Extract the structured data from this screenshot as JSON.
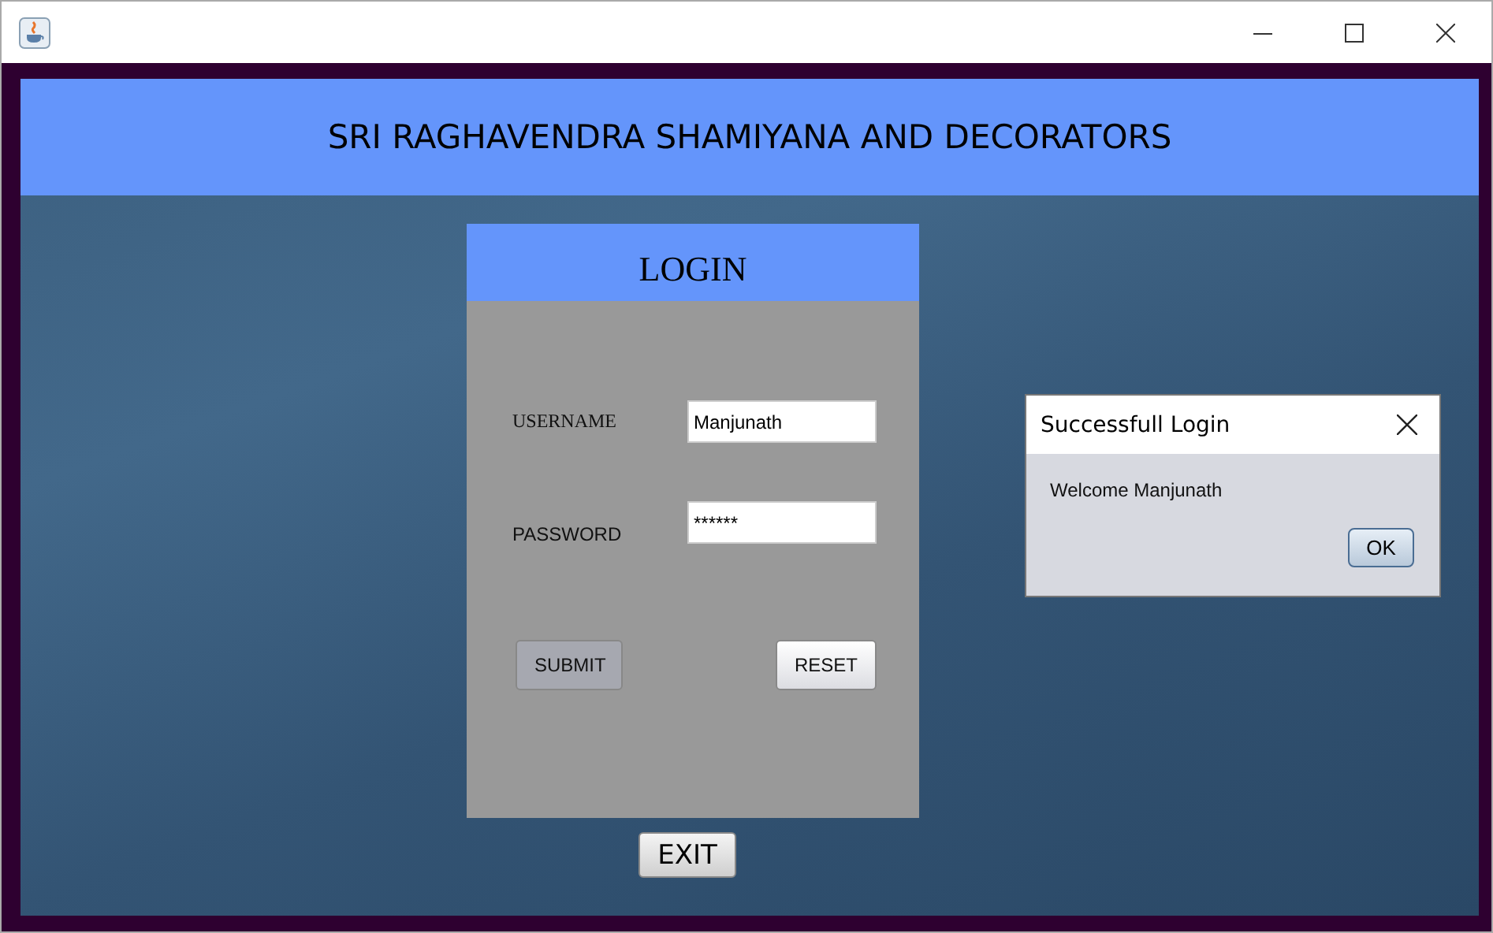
{
  "header": {
    "title": "SRI RAGHAVENDRA SHAMIYANA AND DECORATORS"
  },
  "login": {
    "title": "LOGIN",
    "fields": [
      {
        "label": "USERNAME",
        "value": "Manjunath",
        "kind": "text"
      },
      {
        "label": "PASSWORD",
        "value": "******",
        "kind": "password"
      }
    ],
    "buttons": [
      {
        "label": "SUBMIT",
        "selected": true
      },
      {
        "label": "RESET",
        "selected": false
      }
    ]
  },
  "exit_button": "EXIT",
  "dialog": {
    "title": "Successfull Login",
    "message": "Welcome Manjunath",
    "button": "OK"
  }
}
